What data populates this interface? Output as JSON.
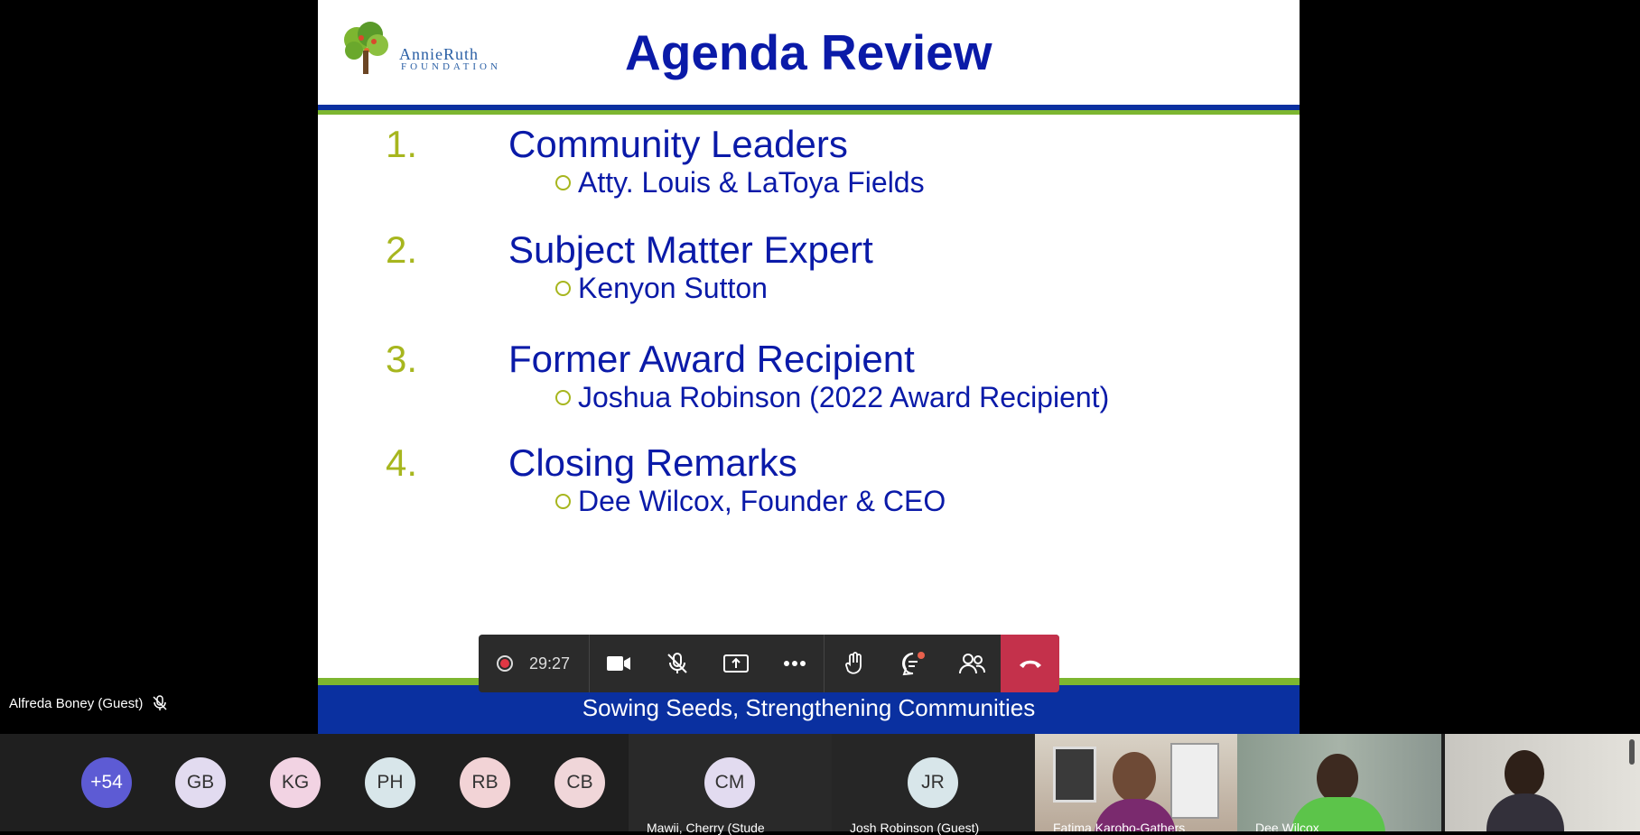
{
  "slide": {
    "logo_name": "AnnieRuth",
    "logo_sub": "FOUNDATION",
    "title": "Agenda Review",
    "items": [
      {
        "num": "1.",
        "heading": "Community Leaders",
        "sub": "Atty. Louis & LaToya Fields"
      },
      {
        "num": "2.",
        "heading": "Subject Matter Expert",
        "sub": "Kenyon Sutton"
      },
      {
        "num": "3.",
        "heading": "Former Award Recipient",
        "sub": "Joshua Robinson (2022 Award Recipient)"
      },
      {
        "num": "4.",
        "heading": "Closing Remarks",
        "sub": "Dee Wilcox, Founder & CEO"
      }
    ],
    "tagline": "Sowing Seeds, Strengthening Communities"
  },
  "toolbar": {
    "timer": "29:27",
    "buttons": [
      "camera-icon",
      "mic-off-icon",
      "share-screen-icon",
      "more-icon",
      "raise-hand-icon",
      "chat-icon",
      "people-icon",
      "leave-call-icon"
    ]
  },
  "speaker": {
    "name": "Alfreda Boney (Guest)"
  },
  "participants": {
    "more_count": "+54",
    "initials": [
      {
        "label": "GB",
        "color": "#e2dbf0"
      },
      {
        "label": "KG",
        "color": "#f2d3e3"
      },
      {
        "label": "PH",
        "color": "#d8e6ea"
      },
      {
        "label": "RB",
        "color": "#f2d3d6"
      },
      {
        "label": "CB",
        "color": "#f0d6d9"
      }
    ],
    "tiles": [
      {
        "initials": "CM",
        "name": "Mawii, Cherry (Stude"
      },
      {
        "initials": "JR",
        "name": "Josh Robinson (Guest)"
      }
    ],
    "videos": [
      {
        "name": "Fatima Karobo-Gathers"
      },
      {
        "name": "Dee Wilcox"
      },
      {
        "name": ""
      }
    ]
  },
  "colors": {
    "slide_title": "#0a1aa8",
    "numbers": "#a7b61e",
    "slide_blue": "#0a30a0",
    "slide_green": "#7db630",
    "leave": "#c4314b",
    "more_avatar": "#5d5bd4"
  }
}
